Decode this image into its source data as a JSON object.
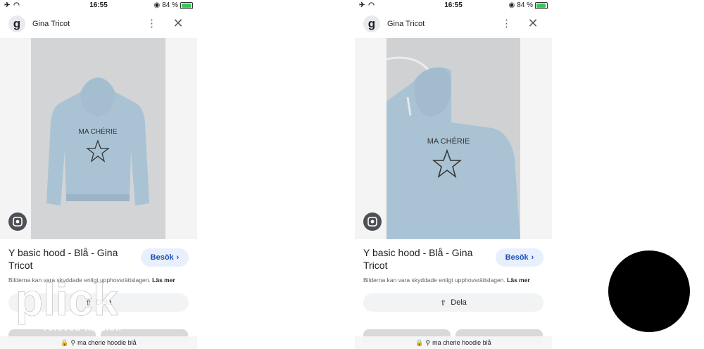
{
  "screens": [
    {
      "status": {
        "time": "16:55",
        "battery": "84 %"
      },
      "site": {
        "logo_letter": "g",
        "name": "Gina Tricot"
      },
      "product": {
        "title": "Y basic hood - Blå - Gina Tricot",
        "visit_label": "Besök",
        "copyright_text": "Bilderna kan vara skyddade enligt upphovsrättslagen.",
        "read_more": "Läs mer",
        "share_label": "Dela"
      },
      "print": {
        "text": "MA CHÉRIE"
      },
      "url_bar": {
        "query": "ma cherie hoodie blå"
      }
    },
    {
      "status": {
        "time": "16:55",
        "battery": "84 %"
      },
      "site": {
        "logo_letter": "g",
        "name": "Gina Tricot"
      },
      "product": {
        "title": "Y basic hood - Blå - Gina Tricot",
        "visit_label": "Besök",
        "copyright_text": "Bilderna kan vara skyddade enligt upphovsrättslagen.",
        "read_more": "Läs mer",
        "share_label": "Dela"
      },
      "print": {
        "text": "MA CHÉRIE"
      },
      "url_bar": {
        "query": "ma cherie hoodie blå"
      }
    }
  ],
  "watermark": {
    "brand": "plick",
    "tagline": "reloved fashion"
  },
  "colors": {
    "hoodie": "#a9c3d4",
    "visit_button_bg": "#e8f0fe",
    "visit_button_text": "#1a4fb4",
    "battery": "#34c759"
  },
  "icons": [
    "airplane-icon",
    "wifi-icon",
    "location-icon",
    "battery-icon",
    "more-vert-icon",
    "close-icon",
    "google-lens-icon",
    "chevron-right-icon",
    "share-icon",
    "lock-icon",
    "search-icon"
  ]
}
